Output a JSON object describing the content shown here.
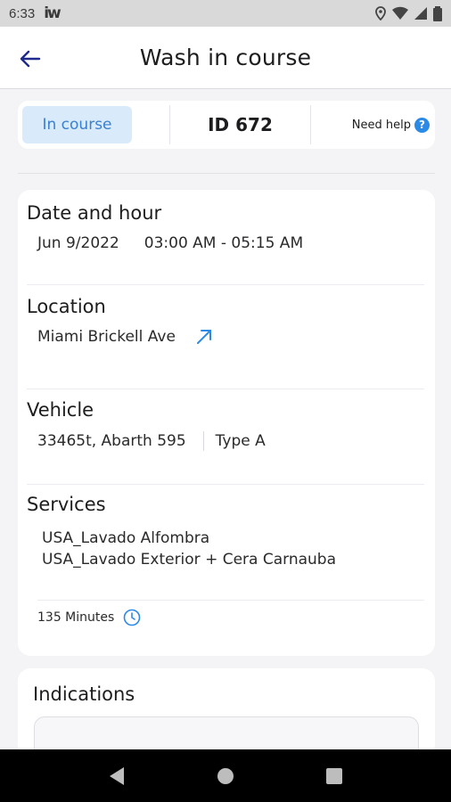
{
  "status_bar": {
    "time": "6:33",
    "app_logo": "iw"
  },
  "header": {
    "title": "Wash in course",
    "back_icon": "arrow-left-icon"
  },
  "summary": {
    "status": "In course",
    "id_label": "ID  672",
    "help_label": "Need help",
    "help_icon": "?"
  },
  "details": {
    "date": {
      "title": "Date and hour",
      "date": "Jun 9/2022",
      "time_range": "03:00 AM - 05:15 AM"
    },
    "location": {
      "title": "Location",
      "value": "Miami Brickell Ave",
      "link_icon": "external-link-arrow-icon"
    },
    "vehicle": {
      "title": "Vehicle",
      "value": "33465t, Abarth 595",
      "type": "Type A"
    },
    "services": {
      "title": "Services",
      "items": [
        "USA_Lavado Alfombra",
        "USA_Lavado Exterior + Cera Carnauba"
      ]
    },
    "duration": {
      "value": "135 Minutes",
      "icon": "clock-icon"
    }
  },
  "indications": {
    "title": "Indications"
  },
  "colors": {
    "accent": "#2b8ae6",
    "badge_bg": "#d9ebfb",
    "badge_text": "#3a7fd0",
    "back_arrow": "#1f2a8a"
  }
}
